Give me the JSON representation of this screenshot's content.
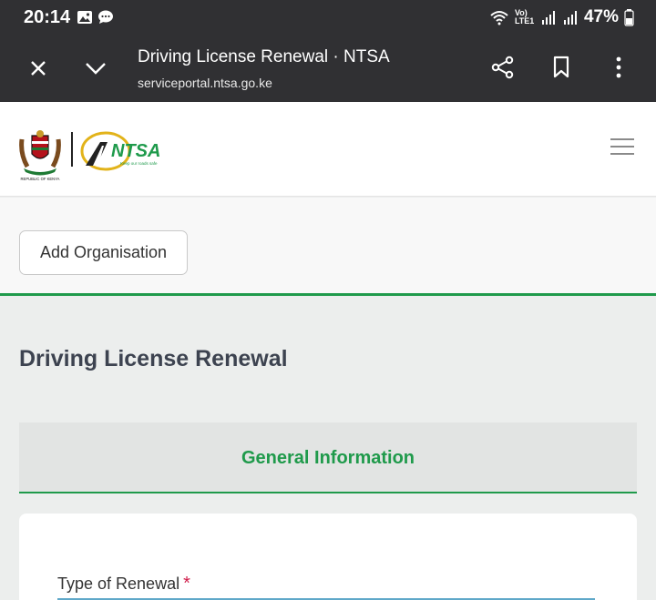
{
  "status_bar": {
    "time": "20:14",
    "network": "Vo) LTE1",
    "battery": "47%"
  },
  "toolbar": {
    "page_title": "Driving License Renewal · NTSA",
    "url": "serviceportal.ntsa.go.ke"
  },
  "header": {
    "coat_caption": "REPUBLIC OF KENYA",
    "logo_text": "NTSA",
    "logo_tagline": "Keep our roads safe"
  },
  "org": {
    "add_button_label": "Add Organisation"
  },
  "main": {
    "title": "Driving License Renewal",
    "tab_label": "General Information",
    "field_label": "Type of Renewal",
    "required_mark": "*"
  },
  "colors": {
    "accent_green": "#1f9a4b",
    "required_red": "#d11f4c",
    "bar_dark": "#303033"
  }
}
